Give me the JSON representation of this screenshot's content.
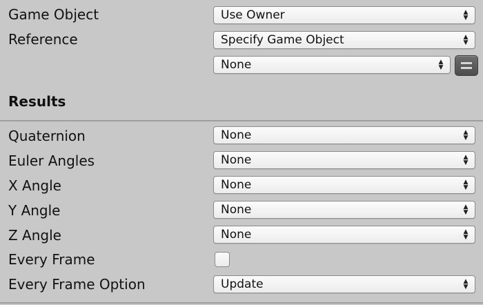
{
  "owner": {
    "game_object_label": "Game Object",
    "game_object_value": "Use Owner",
    "reference_label": "Reference",
    "reference_value": "Specify Game Object",
    "reference_target_value": "None"
  },
  "results": {
    "header": "Results",
    "quaternion_label": "Quaternion",
    "quaternion_value": "None",
    "euler_angles_label": "Euler Angles",
    "euler_angles_value": "None",
    "x_angle_label": "X Angle",
    "x_angle_value": "None",
    "y_angle_label": "Y Angle",
    "y_angle_value": "None",
    "z_angle_label": "Z Angle",
    "z_angle_value": "None",
    "every_frame_label": "Every Frame",
    "every_frame_checked": false,
    "every_frame_option_label": "Every Frame Option",
    "every_frame_option_value": "Update"
  },
  "icons": {
    "dropdown_arrow": "up-down-chevron-icon",
    "variable_toggle": "equals-icon"
  }
}
